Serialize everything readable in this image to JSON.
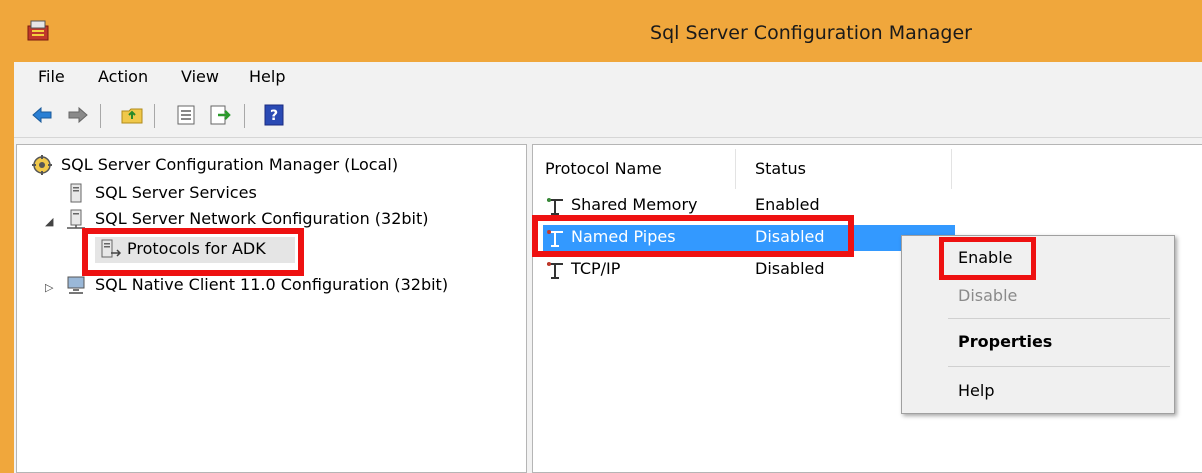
{
  "window": {
    "title": "Sql Server Configuration Manager"
  },
  "menu": [
    "File",
    "Action",
    "View",
    "Help"
  ],
  "toolbar": {
    "buttons": [
      "back-icon",
      "forward-icon",
      "up-folder-icon",
      "properties-icon",
      "export-list-icon",
      "help-icon"
    ]
  },
  "tree": {
    "root": "SQL Server Configuration Manager (Local)",
    "nodes": [
      "SQL Server Services",
      "SQL Server Network Configuration (32bit)",
      "Protocols for ADK",
      "SQL Native Client 11.0 Configuration (32bit)"
    ]
  },
  "list": {
    "headers": [
      "Protocol Name",
      "Status"
    ],
    "rows": [
      {
        "name": "Shared Memory",
        "status": "Enabled"
      },
      {
        "name": "Named Pipes",
        "status": "Disabled"
      },
      {
        "name": "TCP/IP",
        "status": "Disabled"
      }
    ]
  },
  "context_menu": {
    "items": [
      "Enable",
      "Disable",
      "Properties",
      "Help"
    ]
  },
  "colors": {
    "titlebar": "#f0a73c",
    "selection": "#3399ff",
    "highlight": "#ee1111"
  }
}
